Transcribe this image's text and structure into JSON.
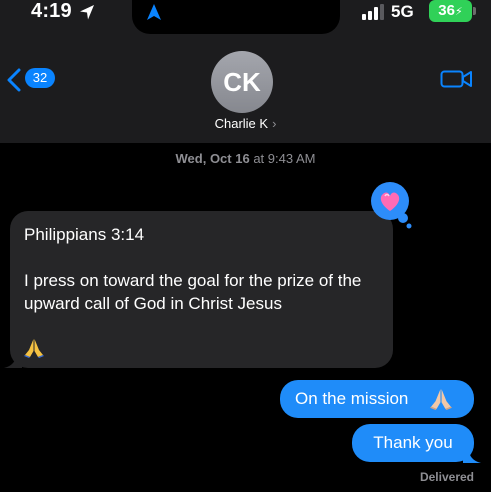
{
  "status_bar": {
    "time": "4:19",
    "network": "5G",
    "battery": "36",
    "icons": [
      "location-arrow-icon",
      "navigation-arrow-icon",
      "signal-bars-icon",
      "battery-icon"
    ]
  },
  "header": {
    "unread_count": "32",
    "avatar_initials": "CK",
    "contact_name": "Charlie K",
    "contact_chevron": "›",
    "icons": [
      "back-chevron-icon",
      "video-call-icon"
    ],
    "accent_color": "#0a84ff"
  },
  "conversation": {
    "timestamp_day": "Wed, Oct 16",
    "timestamp_time": "at 9:43 AM",
    "messages": [
      {
        "direction": "incoming",
        "lines": [
          "Philippians 3:14",
          "I press on toward the goal for the prize of the upward call of God in Christ Jesus"
        ],
        "emoji": "folded-hands-emoji",
        "tapback": "heart-icon"
      },
      {
        "direction": "outgoing",
        "text": "On the mission",
        "emoji": "folded-hands-emoji"
      },
      {
        "direction": "outgoing",
        "text": "Thank you"
      }
    ],
    "delivery_status": "Delivered"
  },
  "colors": {
    "incoming_bubble": "#262628",
    "outgoing_bubble": "#1f8cf9",
    "battery": "#30d158",
    "background": "#000000"
  }
}
